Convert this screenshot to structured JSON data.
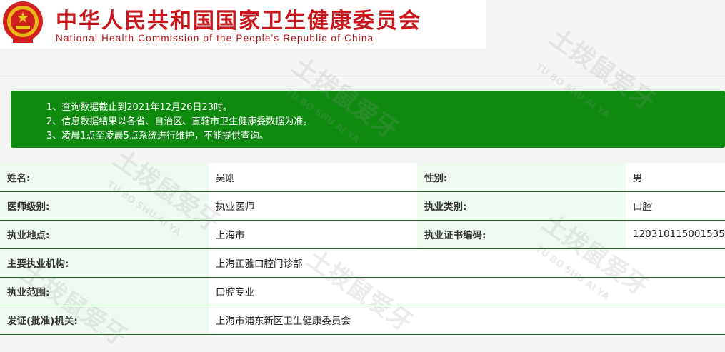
{
  "header": {
    "title_cn": "中华人民共和国国家卫生健康委员会",
    "title_en": "National Health Commission of the People's Republic of China",
    "emblem_icon": "national-emblem-icon"
  },
  "notice": {
    "lines": [
      "1、查询数据截止到2021年12月26日23时。",
      "2、信息数据结果以各省、自治区、直辖市卫生健康委数据为准。",
      "3、凌晨1点至凌晨5点系统进行维护，不能提供查询。"
    ],
    "background": "#0f8a0f"
  },
  "record": {
    "name_label": "姓名:",
    "name_value": "吴刚",
    "gender_label": "性别:",
    "gender_value": "男",
    "level_label": "医师级别:",
    "level_value": "执业医师",
    "category_label": "执业类别:",
    "category_value": "口腔",
    "location_label": "执业地点:",
    "location_value": "上海市",
    "cert_label": "执业证书编码:",
    "cert_value": "120310115001535",
    "org_label": "主要执业机构:",
    "org_value": "上海正雅口腔门诊部",
    "scope_label": "执业范围:",
    "scope_value": "口腔专业",
    "issuer_label": "发证(批准)机关:",
    "issuer_value": "上海市浦东新区卫生健康委员会"
  },
  "watermark": {
    "cn": "土拨鼠爱牙",
    "en": "TU BO SHU AI YA"
  },
  "colors": {
    "title_red": "#c8161d",
    "label_bg": "#effaf1",
    "border_green": "#1f6b1f"
  }
}
